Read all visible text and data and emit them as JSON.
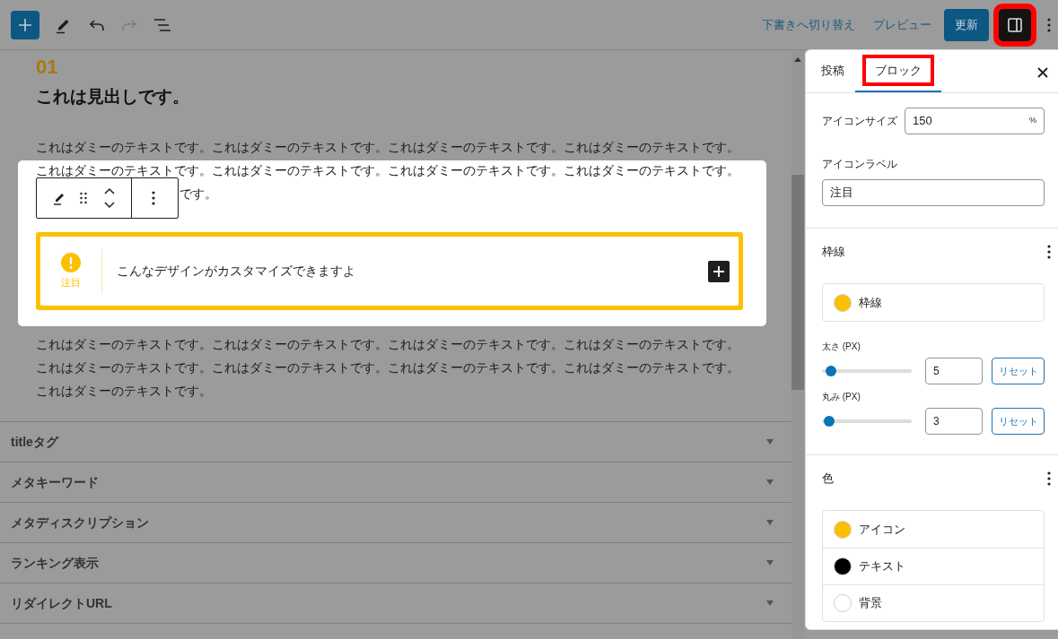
{
  "toolbar": {
    "redo": {
      "disabled": true
    },
    "links": [
      "下書きへ切り替え",
      "プレビュー"
    ],
    "update_button": "更新",
    "sidebar_toggle": {
      "on": true,
      "highlighted": true
    }
  },
  "content": {
    "number": "01",
    "heading": "これは見出しです。",
    "paragraph_1": {
      "lines": [
        "これはダミーのテキストです。これはダミーのテキストです。これはダミーのテキストです。これはダミーのテキストです。",
        "これはダミーのテキストです。これはダミーのテキストです。これはダミーのテキストです。これはダミーのテキストです。"
      ],
      "visible_tail": "です。"
    },
    "callout": {
      "icon_label": "注目",
      "text": "こんなデザインがカスタマイズできますよ"
    },
    "paragraph_2": {
      "lines": [
        "これはダミーのテキストです。これはダミーのテキストです。これはダミーのテキストです。これはダミーのテキストです。",
        "これはダミーのテキストです。これはダミーのテキストです。これはダミーのテキストです。これはダミーのテキストです。",
        "これはダミーのテキストです。"
      ]
    }
  },
  "meta_boxes": [
    {
      "label": "titleタグ",
      "expanded": false
    },
    {
      "label": "メタキーワード",
      "expanded": false
    },
    {
      "label": "メタディスクリプション",
      "expanded": false
    },
    {
      "label": "ランキング表示",
      "expanded": false
    },
    {
      "label": "リダイレクトURL",
      "expanded": false
    }
  ],
  "sidebar": {
    "tabs": [
      {
        "label": "投稿",
        "selected": false,
        "highlighted": false
      },
      {
        "label": "ブロック",
        "selected": true,
        "highlighted": true
      }
    ],
    "icon_size": {
      "label": "アイコンサイズ",
      "value": "150",
      "unit": "%"
    },
    "icon_label": {
      "label": "アイコンラベル",
      "value": "注目"
    },
    "border_section": {
      "title": "枠線",
      "color_items": [
        {
          "label": "枠線",
          "color": "#fcc000"
        }
      ],
      "sliders": [
        {
          "label": "太さ (PX)",
          "level": 0.04,
          "value": "5",
          "reset": "リセット"
        },
        {
          "label": "丸み (PX)",
          "level": 0.02,
          "value": "3",
          "reset": "リセット"
        }
      ]
    },
    "color_section": {
      "title": "色",
      "color_items": [
        {
          "label": "アイコン",
          "color": "#fcc000"
        },
        {
          "label": "テキスト",
          "color": "#000000"
        },
        {
          "label": "背景",
          "color": "#ffffff"
        }
      ]
    }
  }
}
